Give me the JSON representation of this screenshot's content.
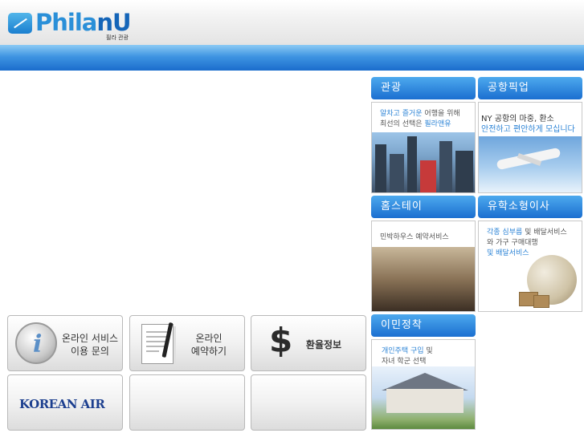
{
  "brand": {
    "name_main": "Phila",
    "name_accent": "nU",
    "subtitle": "필라 관광"
  },
  "tiles": [
    {
      "title": "관광",
      "lines": [
        [
          {
            "t": "알차고 즐거운",
            "hl": true
          },
          {
            "t": " 어행을 위해",
            "hl": false
          }
        ],
        [
          {
            "t": "최선의 선택은 ",
            "hl": false
          },
          {
            "t": "필라앤유",
            "hl": true
          }
        ]
      ]
    },
    {
      "title": "공항픽업",
      "lines": [
        [
          {
            "t": "NY 공항의 마중, 환소",
            "hl": false
          }
        ],
        [
          {
            "t": "안전하고 편안하게 모십니다",
            "hl": true
          }
        ]
      ]
    },
    {
      "title": "홈스테이",
      "lines": [
        [
          {
            "t": "민박하우스",
            "hl": false
          },
          {
            "t": " 예약서비스",
            "hl": false
          }
        ]
      ]
    },
    {
      "title": "유학소형이사",
      "lines": [
        [
          {
            "t": "각종 심부름",
            "hl": true
          },
          {
            "t": " 및 배달서비스",
            "hl": false
          }
        ],
        [
          {
            "t": "와 가구 구매대행",
            "hl": false
          }
        ],
        [
          {
            "t": "및 배달서비스",
            "hl": true
          }
        ]
      ]
    },
    {
      "title": "이민정착",
      "lines": [
        [
          {
            "t": "개인주택 구입",
            "hl": true
          },
          {
            "t": " 및",
            "hl": false
          }
        ],
        [
          {
            "t": "자녀 학군 선택",
            "hl": false
          }
        ]
      ]
    }
  ],
  "buttons": {
    "inquiry": {
      "line1": "온라인 서비스",
      "line2": "이용 문의"
    },
    "booking": {
      "line1": "온라인",
      "line2": "예약하기"
    },
    "exchange": {
      "label": "환율정보",
      "symbol": "$"
    },
    "korean_air": {
      "label": "KOREAN AIR"
    }
  },
  "colors": {
    "accent": "#2d84d6",
    "nav": "#1a6ccc"
  }
}
